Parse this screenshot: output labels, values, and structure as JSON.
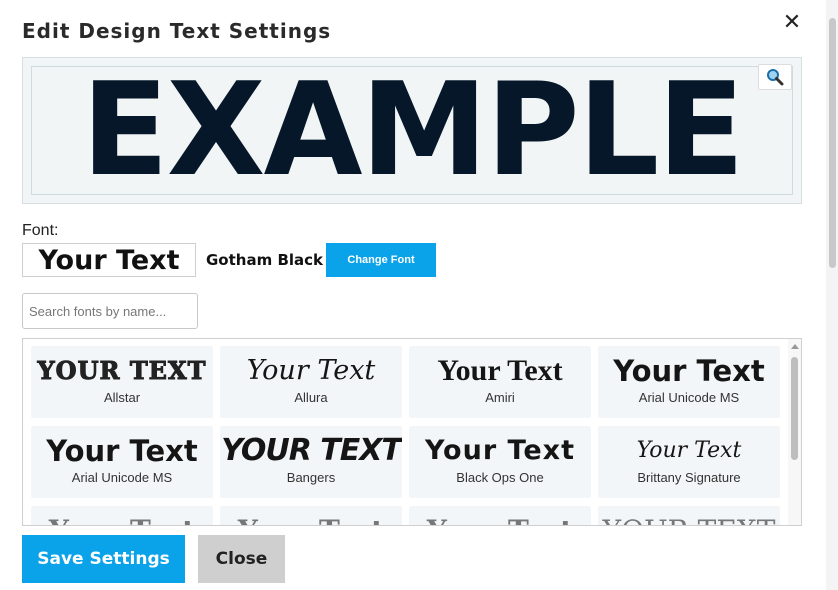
{
  "dialog": {
    "title": "Edit Design Text Settings",
    "close_icon": "close-icon"
  },
  "preview": {
    "text": "EXAMPLE",
    "text_color": "#06172a",
    "background_color": "#f1f5f6",
    "zoom_icon": "magnifier-icon"
  },
  "font": {
    "label": "Font:",
    "sample_text": "Your Text",
    "current_name": "Gotham Black",
    "change_button": "Change Font"
  },
  "search": {
    "placeholder": "Search fonts by name...",
    "value": ""
  },
  "font_grid": {
    "tiles": [
      {
        "sample": "YOUR TEXT",
        "name": "Allstar"
      },
      {
        "sample": "Your Text",
        "name": "Allura"
      },
      {
        "sample": "Your Text",
        "name": "Amiri"
      },
      {
        "sample": "Your Text",
        "name": "Arial Unicode MS"
      },
      {
        "sample": "Your Text",
        "name": "Arial Unicode MS"
      },
      {
        "sample": "YOUR TEXT",
        "name": "Bangers"
      },
      {
        "sample": "Your Text",
        "name": "Black Ops One"
      },
      {
        "sample": "Your Text",
        "name": "Brittany Signature"
      },
      {
        "sample": "Your Text",
        "name": ""
      },
      {
        "sample": "Your Text",
        "name": ""
      },
      {
        "sample": "Your Text",
        "name": ""
      },
      {
        "sample": "YOUR TEXT",
        "name": ""
      }
    ]
  },
  "footer": {
    "save_label": "Save Settings",
    "close_label": "Close"
  },
  "colors": {
    "accent": "#0aa2e8",
    "secondary_button": "#cfcfcf"
  }
}
